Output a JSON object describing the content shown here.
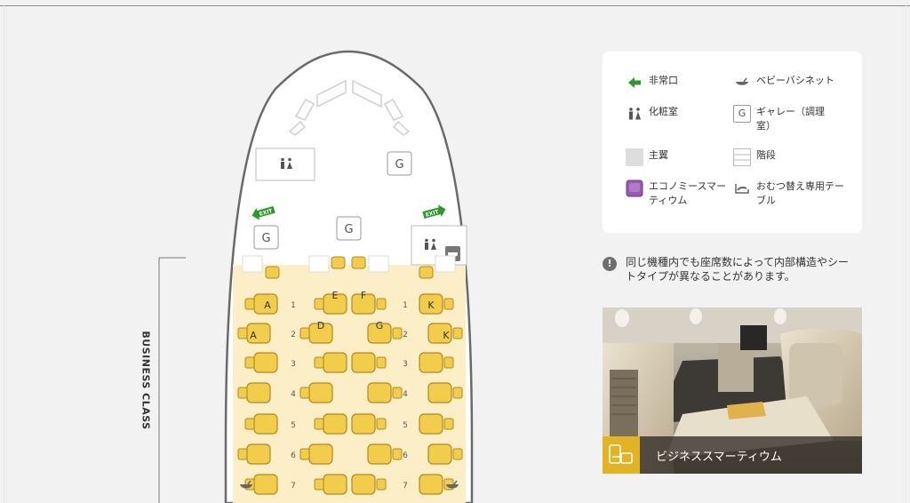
{
  "section": {
    "label": "BUSINESS CLASS"
  },
  "seat_map": {
    "column_letters": {
      "A": "A",
      "D": "D",
      "E": "E",
      "F": "F",
      "G": "G",
      "K": "K"
    },
    "rows": [
      "1",
      "2",
      "3",
      "4",
      "5",
      "6",
      "7"
    ],
    "galley_symbol": "G",
    "exit_label": "EXIT"
  },
  "legend": {
    "items": [
      {
        "icon": "exit-arrow-icon",
        "label": "非常口"
      },
      {
        "icon": "bassinet-icon",
        "label": "ベビーバシネット"
      },
      {
        "icon": "lavatory-icon",
        "label": "化粧室"
      },
      {
        "icon": "galley-icon",
        "label": "ギャレー（調理室）"
      },
      {
        "icon": "closet-icon",
        "label": "主翼"
      },
      {
        "icon": "stairs-icon",
        "label": "階段"
      },
      {
        "icon": "economy-smartium-seat-icon",
        "label": "エコノミースマーティウム"
      },
      {
        "icon": "changing-table-icon",
        "label": "おむつ替え専用テーブル"
      }
    ],
    "galley_symbol": "G"
  },
  "note": {
    "icon": "info-icon",
    "symbol": "!",
    "text": "同じ機種内でも座席数によって内部構造やシートタイプが異なることがあります。"
  },
  "photo": {
    "caption": "ビジネススマーティウム",
    "icon": "business-seat-icon"
  },
  "colors": {
    "seat_fill": "#f2cc4b",
    "seat_stroke": "#b28a1d",
    "cabin_fill": "#fcefc8",
    "exit_green": "#2a9a2a",
    "smartium_purple": "#9b59b6",
    "caption_accent": "#e3b323"
  }
}
